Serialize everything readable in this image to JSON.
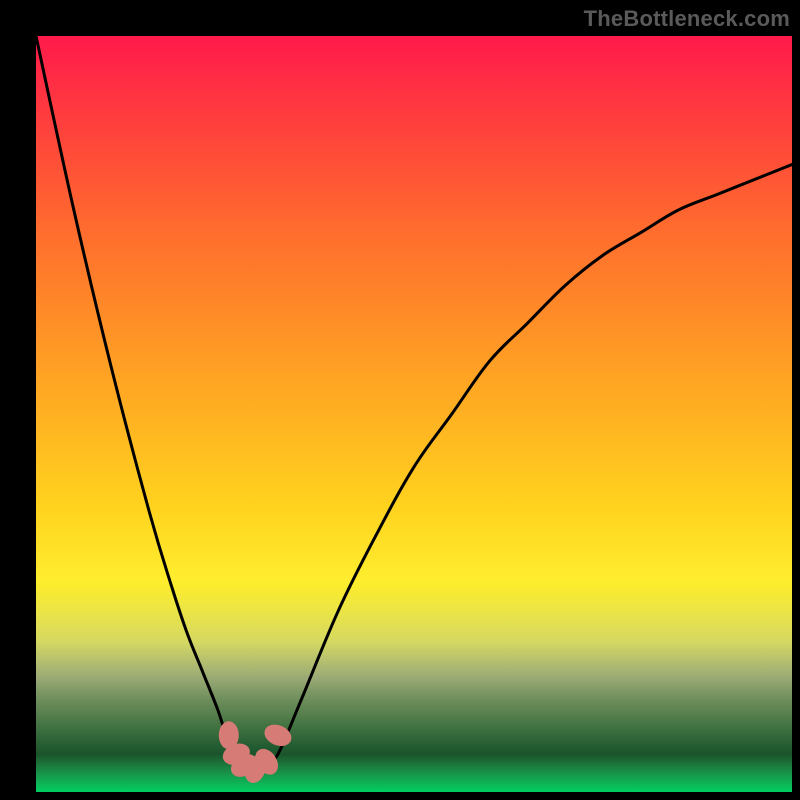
{
  "watermark": "TheBottleneck.com",
  "chart_data": {
    "type": "line",
    "title": "",
    "xlabel": "",
    "ylabel": "",
    "xlim": [
      0,
      100
    ],
    "ylim": [
      0,
      100
    ],
    "grid": false,
    "legend": false,
    "series": [
      {
        "name": "bottleneck-curve",
        "x": [
          0,
          5,
          10,
          15,
          18,
          20,
          22,
          24,
          25,
          26,
          27,
          28,
          29,
          30,
          32,
          35,
          40,
          45,
          50,
          55,
          60,
          65,
          70,
          75,
          80,
          85,
          90,
          95,
          100
        ],
        "values": [
          100,
          77,
          56,
          37,
          27,
          21,
          16,
          11,
          8,
          6,
          4,
          3,
          2.5,
          3,
          5,
          12,
          24,
          34,
          43,
          50,
          57,
          62,
          67,
          71,
          74,
          77,
          79,
          81,
          83
        ]
      }
    ],
    "markers": [
      {
        "x": 25.5,
        "y": 7.5
      },
      {
        "x": 26.5,
        "y": 5.0
      },
      {
        "x": 27.5,
        "y": 3.5
      },
      {
        "x": 29.0,
        "y": 3.0
      },
      {
        "x": 30.5,
        "y": 4.0
      },
      {
        "x": 32.0,
        "y": 7.5
      }
    ],
    "gradient_stops": [
      {
        "offset": 0.0,
        "color": "#ff1a4b"
      },
      {
        "offset": 0.1,
        "color": "#ff3a3f"
      },
      {
        "offset": 0.25,
        "color": "#ff6a2e"
      },
      {
        "offset": 0.45,
        "color": "#ffa323"
      },
      {
        "offset": 0.62,
        "color": "#ffd21e"
      },
      {
        "offset": 0.73,
        "color": "#fff030"
      },
      {
        "offset": 0.8,
        "color": "#fcff70"
      },
      {
        "offset": 0.85,
        "color": "#e8ffb0"
      },
      {
        "offset": 0.9,
        "color": "#aaff9a"
      },
      {
        "offset": 0.95,
        "color": "#4cf07c"
      },
      {
        "offset": 1.0,
        "color": "#00e56a"
      }
    ],
    "band_opacity_stops": [
      {
        "offset": 0.0,
        "opacity": 1.0
      },
      {
        "offset": 0.72,
        "opacity": 1.0
      },
      {
        "offset": 0.8,
        "opacity": 0.85
      },
      {
        "offset": 0.88,
        "opacity": 0.55
      },
      {
        "offset": 0.95,
        "opacity": 0.35
      },
      {
        "offset": 1.0,
        "opacity": 0.9
      }
    ],
    "marker_color": "#d77b77",
    "curve_color": "#000000",
    "curve_width": 3
  }
}
